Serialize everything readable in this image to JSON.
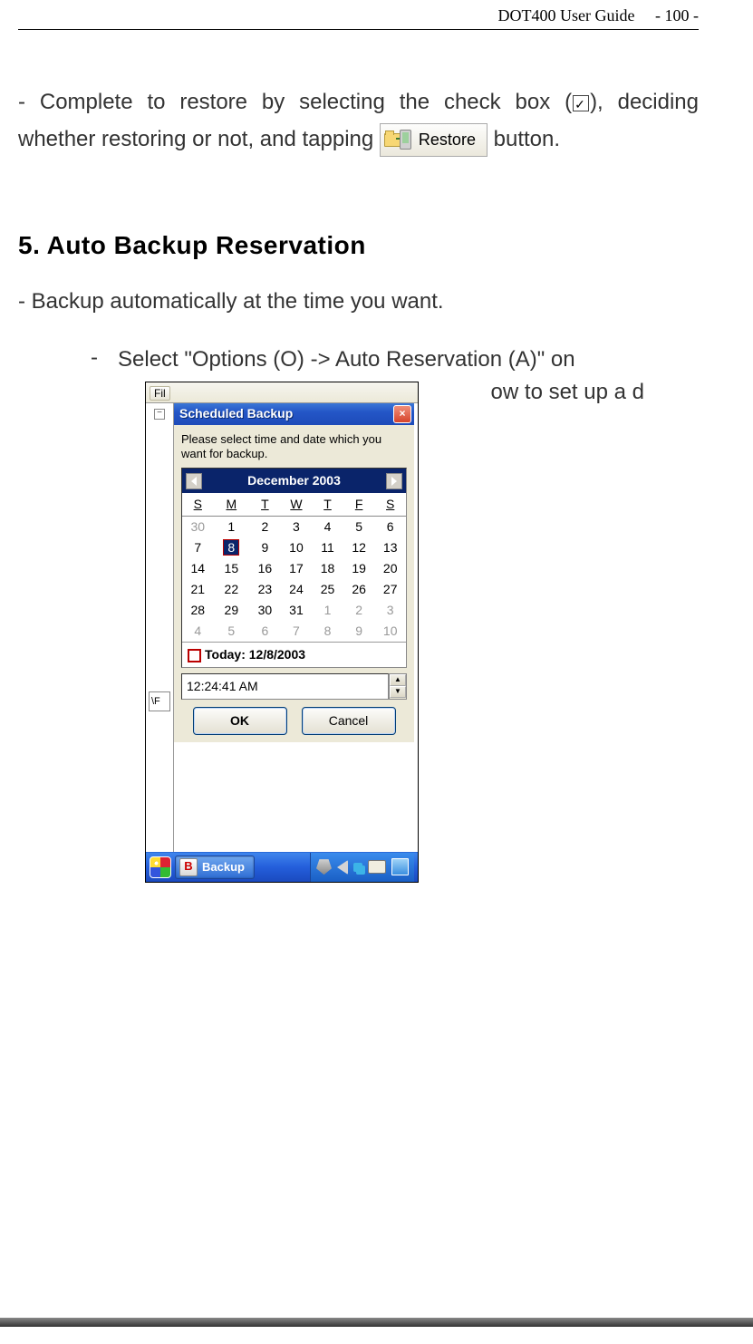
{
  "header": {
    "title": "DOT400 User Guide",
    "page": "- 100 -"
  },
  "para1": {
    "line1": "- Complete to restore by selecting the check box (",
    "line1b": "), deciding whether restoring or not, and tapping ",
    "restoreLabel": "Restore",
    "line1c": " button."
  },
  "section_title": "5. Auto Backup Reservation",
  "subline": "- Backup automatically at the time you want.",
  "bullet": {
    "dash": "-",
    "textA": "Select \"Options (O) -> Auto Reservation (A)\" on ",
    "textB": "ow to set up a d",
    "menulabel": "Fil"
  },
  "screenshot": {
    "leftMinus": "−",
    "fpath": "\\F",
    "titlebar": "Scheduled Backup",
    "closeX": "×",
    "instructions": "Please select time and date which you want for backup.",
    "cal": {
      "month": "December 2003",
      "dayHeaders": [
        "S",
        "M",
        "T",
        "W",
        "T",
        "F",
        "S"
      ],
      "weeks": [
        [
          {
            "d": "30",
            "g": true
          },
          {
            "d": "1"
          },
          {
            "d": "2"
          },
          {
            "d": "3"
          },
          {
            "d": "4"
          },
          {
            "d": "5"
          },
          {
            "d": "6"
          }
        ],
        [
          {
            "d": "7"
          },
          {
            "d": "8",
            "today": true
          },
          {
            "d": "9"
          },
          {
            "d": "10"
          },
          {
            "d": "11"
          },
          {
            "d": "12"
          },
          {
            "d": "13"
          }
        ],
        [
          {
            "d": "14"
          },
          {
            "d": "15"
          },
          {
            "d": "16"
          },
          {
            "d": "17"
          },
          {
            "d": "18"
          },
          {
            "d": "19"
          },
          {
            "d": "20"
          }
        ],
        [
          {
            "d": "21"
          },
          {
            "d": "22"
          },
          {
            "d": "23"
          },
          {
            "d": "24"
          },
          {
            "d": "25"
          },
          {
            "d": "26"
          },
          {
            "d": "27"
          }
        ],
        [
          {
            "d": "28"
          },
          {
            "d": "29"
          },
          {
            "d": "30"
          },
          {
            "d": "31"
          },
          {
            "d": "1",
            "g": true
          },
          {
            "d": "2",
            "g": true
          },
          {
            "d": "3",
            "g": true
          }
        ],
        [
          {
            "d": "4",
            "g": true
          },
          {
            "d": "5",
            "g": true
          },
          {
            "d": "6",
            "g": true
          },
          {
            "d": "7",
            "g": true
          },
          {
            "d": "8",
            "g": true
          },
          {
            "d": "9",
            "g": true
          },
          {
            "d": "10",
            "g": true
          }
        ]
      ],
      "todayLabel": "Today: 12/8/2003"
    },
    "time": "12:24:41 AM",
    "okLabel": "OK",
    "cancelLabel": "Cancel",
    "taskbar": {
      "appIcon": "B",
      "appLabel": "Backup"
    }
  }
}
